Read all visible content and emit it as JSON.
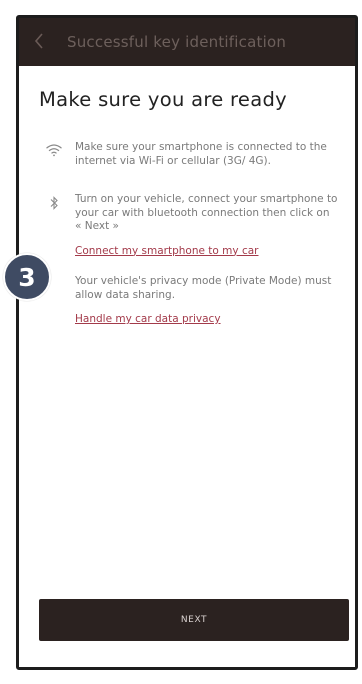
{
  "header": {
    "back_icon": "chevron-left-icon",
    "title": "Successful key identification"
  },
  "page": {
    "title": "Make sure you are ready"
  },
  "steps": [
    {
      "icon": "wifi-icon",
      "text": "Make sure your smartphone is connected to the internet via Wi-Fi or cellular (3G/ 4G)."
    },
    {
      "icon": "bluetooth-icon",
      "text": "Turn on your vehicle, connect your smartphone to your car with bluetooth connection then click on « Next »",
      "link": "Connect my smartphone to my car"
    },
    {
      "icon": "none",
      "text": "Your vehicle's privacy mode (Private Mode) must allow data sharing.",
      "link": "Handle my car data privacy"
    }
  ],
  "footer": {
    "next_label": "NEXT"
  },
  "badge": {
    "number": "3",
    "color": "#3f4b63"
  }
}
